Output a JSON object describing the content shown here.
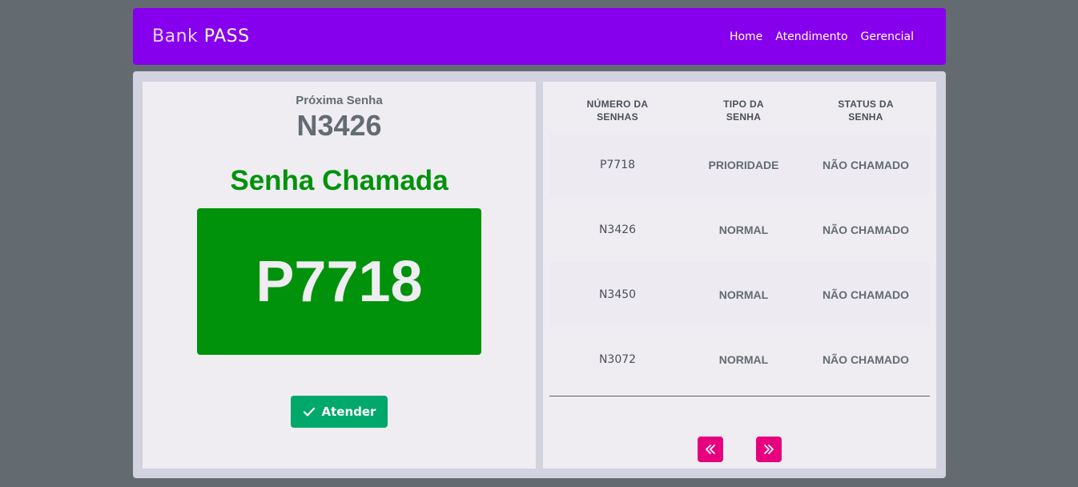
{
  "navbar": {
    "brand_part1": "Bank",
    "brand_part2": "PASS",
    "links": [
      "Home",
      "Atendimento",
      "Gerencial"
    ],
    "color": "#8700ed"
  },
  "left_panel": {
    "next_label": "Próxima Senha",
    "next_value": "N3426",
    "called_title": "Senha Chamada",
    "called_value": "P7718",
    "called_color": "#00920b",
    "attend_button": "Atender",
    "attend_icon": "check-icon"
  },
  "table": {
    "headers": [
      [
        "NÚMERO DA",
        "SENHAS"
      ],
      [
        "TIPO DA",
        "SENHA"
      ],
      [
        "STATUS DA",
        "SENHA"
      ]
    ],
    "rows": [
      {
        "numero": "P7718",
        "tipo": "PRIORIDADE",
        "status": "NÃO CHAMADO"
      },
      {
        "numero": "N3426",
        "tipo": "NORMAL",
        "status": "NÃO CHAMADO"
      },
      {
        "numero": "N3450",
        "tipo": "NORMAL",
        "status": "NÃO CHAMADO"
      },
      {
        "numero": "N3072",
        "tipo": "NORMAL",
        "status": "NÃO CHAMADO"
      }
    ]
  },
  "pagination": {
    "prev_icon": "double-chevron-left-icon",
    "next_icon": "double-chevron-right-icon",
    "color": "#e6007e"
  }
}
